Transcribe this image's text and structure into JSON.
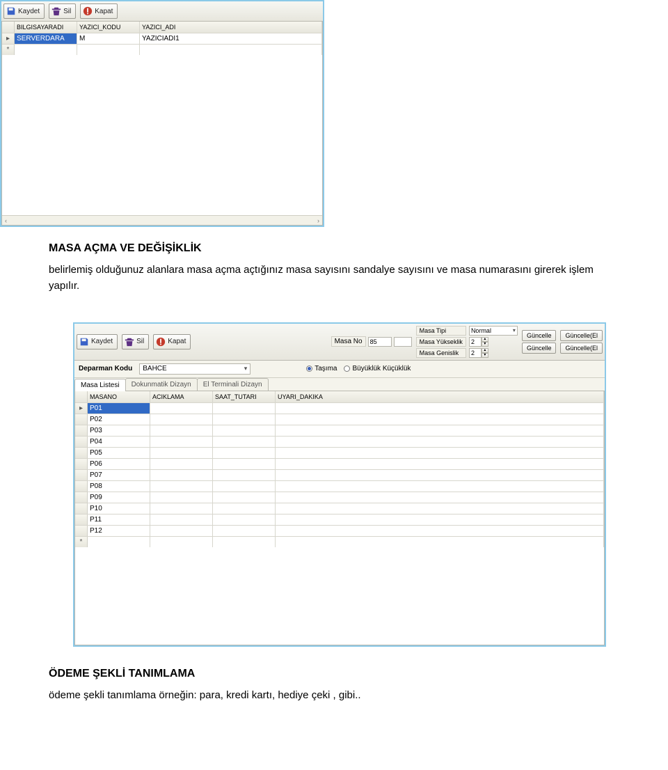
{
  "toolbar": {
    "save": "Kaydet",
    "del": "Sil",
    "close": "Kapat"
  },
  "shot1": {
    "headers": [
      "BILGISAYARADI",
      "YAZICI_KODU",
      "YAZICI_ADI"
    ],
    "row": [
      "SERVERDARA",
      "M",
      "YAZICIADI1"
    ]
  },
  "section1": {
    "heading": "MASA AÇMA VE DEĞİŞİKLİK",
    "body": "belirlemiş olduğunuz alanlara masa açma açtığınız masa sayısını sandalye sayısını ve masa numarasını girerek işlem yapılır."
  },
  "shot2": {
    "masaNoLabel": "Masa No",
    "masaNo": "85",
    "masaTipiLabel": "Masa Tipi",
    "masaTipi": "Normal",
    "masaYukLabel": "Masa Yükseklik",
    "masaYuk": "2",
    "masaGenLabel": "Masa Genislik",
    "masaGen": "2",
    "guncelle": "Güncelle",
    "guncelleEl": "Güncelle(El",
    "departmanLabel": "Deparman Kodu",
    "departman": "BAHCE",
    "radio1": "Taşıma",
    "radio2": "Büyüklük Küçüklük",
    "tabs": [
      "Masa Listesi",
      "Dokunmatik Dizayn",
      "El Terminali Dizayn"
    ],
    "headers": [
      "MASANO",
      "ACIKLAMA",
      "SAAT_TUTARI",
      "UYARI_DAKIKA"
    ],
    "rows": [
      "P01",
      "P02",
      "P03",
      "P04",
      "P05",
      "P06",
      "P07",
      "P08",
      "P09",
      "P10",
      "P11",
      "P12"
    ]
  },
  "section2": {
    "heading": "ÖDEME ŞEKLİ TANIMLAMA",
    "body": "ödeme şekli tanımlama örneğin: para, kredi kartı, hediye çeki , gibi.."
  }
}
